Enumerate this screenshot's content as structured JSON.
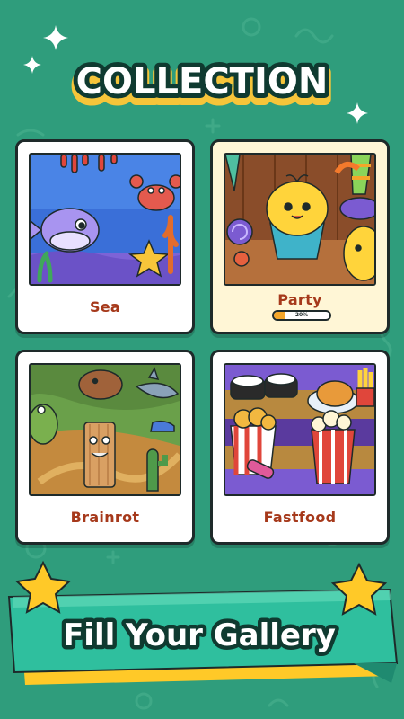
{
  "header": {
    "title": "COLLECTION"
  },
  "collections": [
    {
      "label": "Sea",
      "icon": "sea-artwork"
    },
    {
      "label": "Party",
      "icon": "party-artwork",
      "progress_text": "20%",
      "progress": 0.2
    },
    {
      "label": "Brainrot",
      "icon": "brainrot-artwork"
    },
    {
      "label": "Fastfood",
      "icon": "fastfood-artwork"
    }
  ],
  "banner": {
    "text": "Fill Your Gallery"
  },
  "colors": {
    "background": "#2f9d7c",
    "label": "#a6391b",
    "title_fill": "#ffffff",
    "title_outline": "#0f3a30",
    "title_shadow": "#f6c53a",
    "banner_bg": "#2fbf9e",
    "star": "#ffc928"
  }
}
